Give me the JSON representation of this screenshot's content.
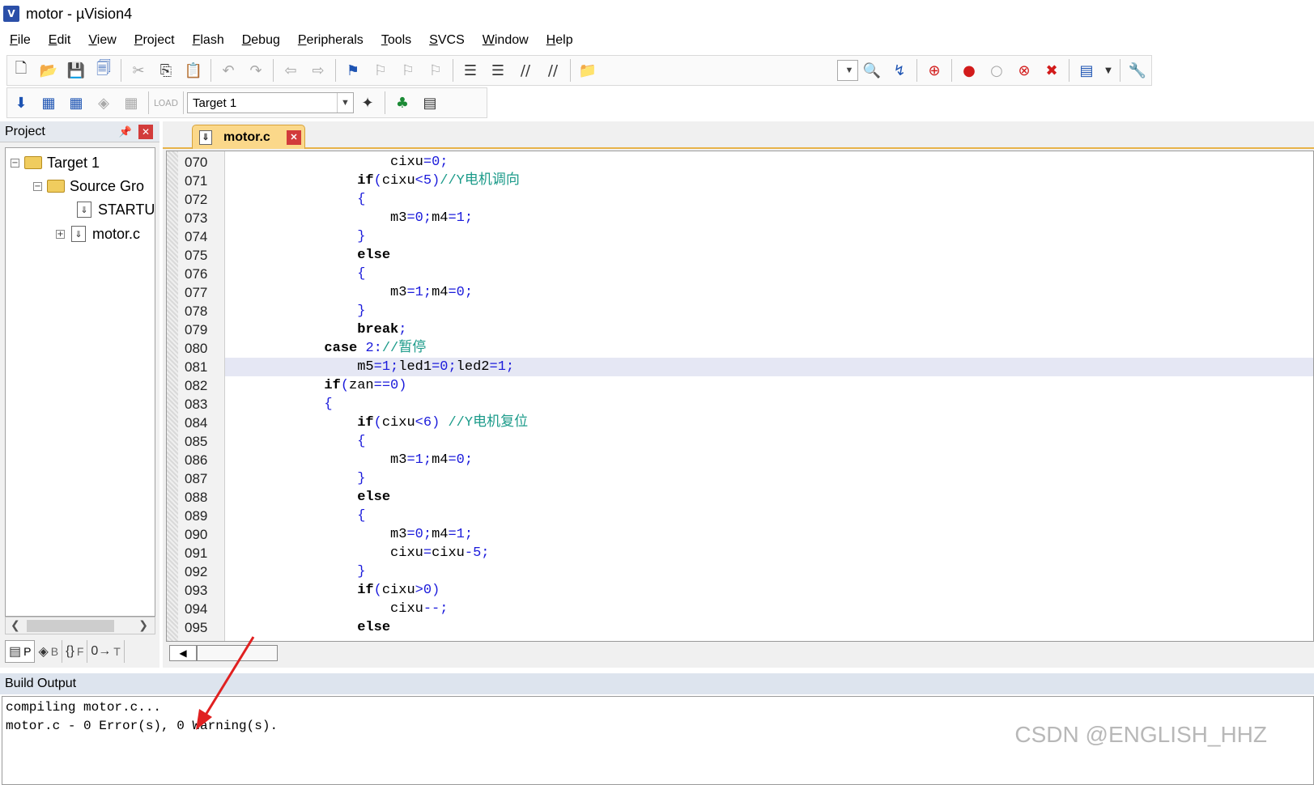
{
  "window": {
    "title": "motor  - µVision4"
  },
  "menu": [
    "File",
    "Edit",
    "View",
    "Project",
    "Flash",
    "Debug",
    "Peripherals",
    "Tools",
    "SVCS",
    "Window",
    "Help"
  ],
  "toolbar2": {
    "target_label": "Target 1"
  },
  "project": {
    "header": "Project",
    "tree": [
      {
        "label": "Target 1",
        "level": 0,
        "expander": "−",
        "icon": "target-folder-icon"
      },
      {
        "label": "Source Gro",
        "level": 1,
        "expander": "−",
        "icon": "folder-icon"
      },
      {
        "label": "STARTU",
        "level": 2,
        "expander": "",
        "icon": "file-icon"
      },
      {
        "label": "motor.c",
        "level": 2,
        "expander": "+",
        "icon": "file-icon"
      }
    ],
    "tabs": [
      "P",
      "B",
      "F",
      "T"
    ]
  },
  "editor": {
    "tab_label": "motor.c",
    "highlighted_line": "081",
    "line_numbers": [
      "070",
      "071",
      "072",
      "073",
      "074",
      "075",
      "076",
      "077",
      "078",
      "079",
      "080",
      "081",
      "082",
      "083",
      "084",
      "085",
      "086",
      "087",
      "088",
      "089",
      "090",
      "091",
      "092",
      "093",
      "094",
      "095"
    ],
    "code": [
      "                    cixu=0;",
      "                if(cixu<5)//Y电机调向",
      "                {",
      "                    m3=0;m4=1;",
      "                }",
      "                else",
      "                {",
      "                    m3=1;m4=0;",
      "                }",
      "                break;",
      "            case 2://暂停",
      "                m5=1;led1=0;led2=1;",
      "            if(zan==0)",
      "            {",
      "                if(cixu<6) //Y电机复位",
      "                {",
      "                    m3=1;m4=0;",
      "                }",
      "                else",
      "                {",
      "                    m3=0;m4=1;",
      "                    cixu=cixu-5;",
      "                }",
      "                if(cixu>0)",
      "                    cixu--;",
      "                else"
    ]
  },
  "build_output": {
    "header": "Build Output",
    "lines": [
      "compiling motor.c...",
      "motor.c - 0 Error(s), 0 Warning(s)."
    ]
  },
  "watermark": "CSDN @ENGLISH_HHZ",
  "colors": {
    "keyword": "#000000",
    "number": "#1b1bdb",
    "comment": "#1c9b8a",
    "tab_accent": "#fbd88a",
    "annotation_arrow": "#e02020"
  }
}
